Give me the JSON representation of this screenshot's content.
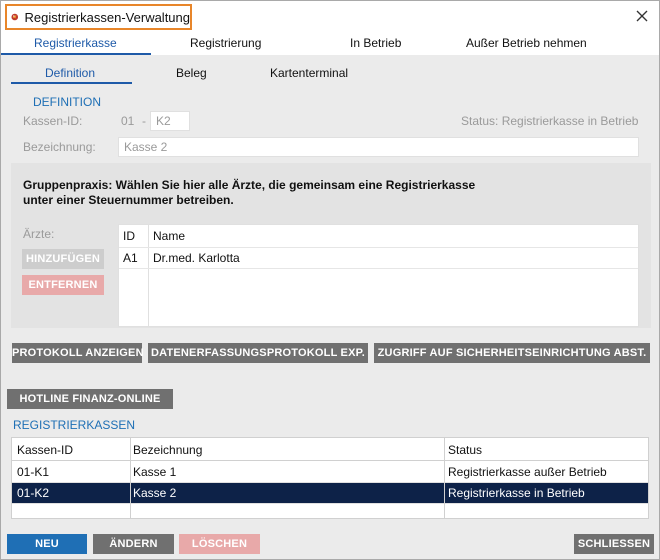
{
  "window": {
    "title": "Registrierkassen-Verwaltung",
    "app_icon": "app-logo-icon",
    "close_icon": "close-icon"
  },
  "main_tabs": [
    {
      "label": "Registrierkasse",
      "active": true
    },
    {
      "label": "Registrierung",
      "active": false
    },
    {
      "label": "In Betrieb",
      "active": false
    },
    {
      "label": "Außer Betrieb nehmen",
      "active": false
    }
  ],
  "sub_tabs": [
    {
      "label": "Definition",
      "active": true
    },
    {
      "label": "Beleg",
      "active": false
    },
    {
      "label": "Kartenterminal",
      "active": false
    }
  ],
  "definition": {
    "heading": "DEFINITION",
    "kassen_id_label": "Kassen-ID:",
    "kassen_id_prefix": "01",
    "kassen_id_separator": "-",
    "kassen_id_value": "K2",
    "status_text": "Status: Registrierkasse in Betrieb",
    "bezeichnung_label": "Bezeichnung:",
    "bezeichnung_value": "Kasse 2"
  },
  "gruppenpraxis": {
    "text_line1": "Gruppenpraxis: Wählen Sie hier alle Ärzte, die gemeinsam eine Registrierkasse",
    "text_line2": "unter einer Steuernummer betreiben.",
    "aerzte_label": "Ärzte:",
    "add_button": "HINZUFÜGEN",
    "remove_button": "ENTFERNEN",
    "columns": [
      "ID",
      "Name"
    ],
    "rows": [
      {
        "id": "A1",
        "name": "Dr.med. Karlotta"
      }
    ]
  },
  "actions": {
    "protokoll": "PROTOKOLL ANZEIGEN",
    "datenerfassung": "DATENERFASSUNGSPROTOKOLL EXP.",
    "zugriff": "ZUGRIFF AUF SICHERHEITSEINRICHTUNG ABST.",
    "hotline": "HOTLINE FINANZ-ONLINE"
  },
  "registrierkassen": {
    "heading": "REGISTRIERKASSEN",
    "columns": [
      "Kassen-ID",
      "Bezeichnung",
      "Status"
    ],
    "rows": [
      {
        "id": "01-K1",
        "name": "Kasse 1",
        "status": "Registrierkasse außer Betrieb",
        "selected": false
      },
      {
        "id": "01-K2",
        "name": "Kasse 2",
        "status": "Registrierkasse in Betrieb",
        "selected": true
      }
    ]
  },
  "footer": {
    "neu": "NEU",
    "aendern": "ÄNDERN",
    "loeschen": "LÖSCHEN",
    "schliessen": "SCHLIESSEN"
  },
  "colors": {
    "accent": "#1f6fb5",
    "selection": "#0d2248",
    "title_highlight": "#e8862a"
  }
}
